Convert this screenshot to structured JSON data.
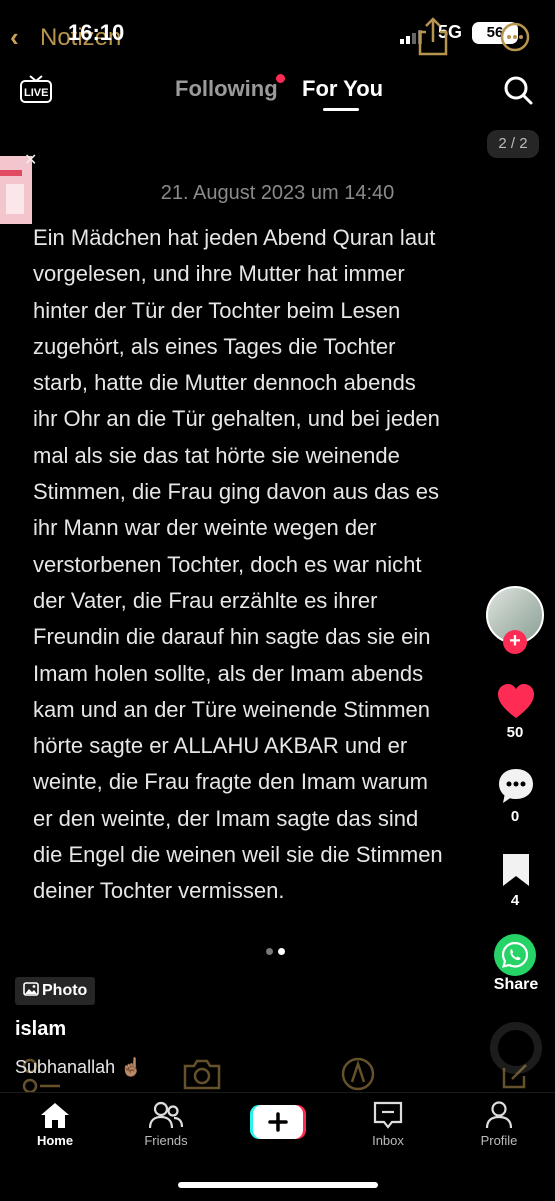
{
  "status_bar": {
    "back_app": "Notizen",
    "time": "16:10",
    "network": "5G",
    "battery": "56"
  },
  "top_nav": {
    "live_label": "LIVE",
    "tabs": [
      {
        "label": "Following",
        "active": false,
        "has_dot": true
      },
      {
        "label": "For You",
        "active": true
      }
    ],
    "page_indicator": "2 / 2"
  },
  "note": {
    "date": "21. August 2023 um 14:40",
    "lines": [
      "Ein Mädchen hat jeden Abend Quran laut",
      "vorgelesen, und ihre Mutter hat immer",
      "hinter der Tür der Tochter beim Lesen",
      "zugehört, als eines Tages die Tochter",
      "starb, hatte die Mutter dennoch abends",
      "ihr Ohr an die Tür gehalten, und bei jeden",
      "mal als sie das tat hörte sie weinende",
      "Stimmen, die Frau ging davon aus das es",
      "ihr Mann war der weinte wegen der",
      "verstorbenen Tochter, doch es war nicht",
      "der Vater, die Frau erzählte es ihrer",
      "Freundin die darauf hin sagte das sie ein",
      "Imam holen sollte, als der Imam abends",
      "kam und an der Türe weinende Stimmen",
      "hörte sagte er ALLAHU AKBAR und er",
      "weinte, die Frau fragte den Imam warum",
      "er den weinte, der Imam sagte das sind",
      "die Engel die weinen weil sie die Stimmen",
      "deiner Tochter vermissen."
    ]
  },
  "carousel": {
    "total": 2,
    "current": 2
  },
  "actions": {
    "likes": "50",
    "comments": "0",
    "bookmarks": "4",
    "share_label": "Share"
  },
  "post": {
    "photo_tag": "Photo",
    "username": "islam",
    "caption": "Subhanallah ☝🏽"
  },
  "bottom_nav": [
    {
      "label": "Home",
      "active": true
    },
    {
      "label": "Friends"
    },
    {
      "label": ""
    },
    {
      "label": "Inbox"
    },
    {
      "label": "Profile"
    }
  ],
  "colors": {
    "accent_red": "#fe2c55",
    "whatsapp_green": "#25d366",
    "background": "#000000"
  }
}
